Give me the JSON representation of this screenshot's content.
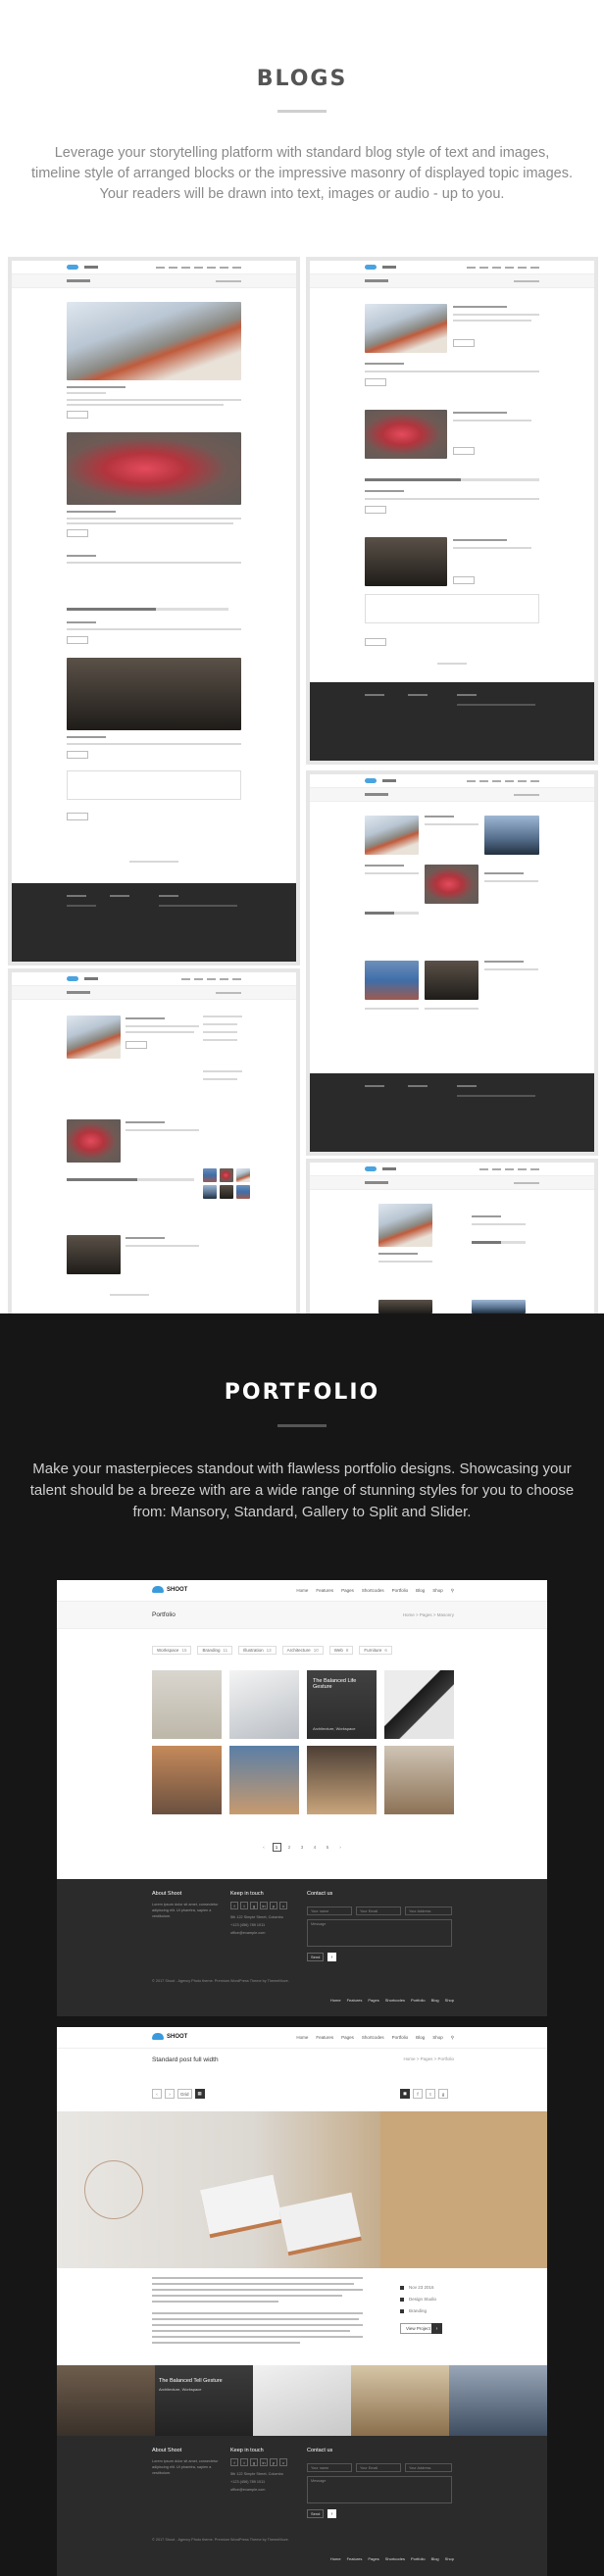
{
  "blogs": {
    "title": "BLOGS",
    "description": "Leverage your storytelling platform with standard blog style of text and images, timeline style of arranged blocks or the impressive masonry of displayed topic images. Your readers will be drawn into text, images or audio - up to you."
  },
  "portfolio": {
    "title": "PORTFOLIO",
    "description": "Make your masterpieces standout with flawless portfolio designs. Showcasing your talent should be a breeze with are a wide range of stunning styles for you to choose from: Mansory, Standard, Gallery to Split and Slider."
  },
  "shot1": {
    "logo": "SHOOT",
    "nav": [
      "Home",
      "Features",
      "Pages",
      "Shortcodes",
      "Portfolio",
      "Blog",
      "Shop"
    ],
    "page_title": "Portfolio",
    "breadcrumb": "Home > Pages > Masonry",
    "filters": [
      {
        "label": "Workspace",
        "count": "15"
      },
      {
        "label": "Branding",
        "count": "11"
      },
      {
        "label": "Illustration",
        "count": "13"
      },
      {
        "label": "Architecture",
        "count": "10"
      },
      {
        "label": "Web",
        "count": "8"
      },
      {
        "label": "Furniture",
        "count": "6"
      }
    ],
    "tile3_caption": "The Balanced Life Gesture",
    "tile3_sub": "Architecture, Workspace",
    "pages": [
      "‹",
      "1",
      "2",
      "3",
      "4",
      "5",
      "›"
    ],
    "footer": {
      "about_title": "About Shoot",
      "about_text": "Lorem ipsum dolor sit amet, consectetur adipiscing elit. Ut pharetra, sapien a vestibulum.",
      "keep_title": "Keep in touch",
      "social": [
        "f",
        "t",
        "g",
        "in",
        "p",
        "v"
      ],
      "address": "5th 122 Simple Street, Colombo",
      "phone": "+123 (456) 789 1011",
      "email": "office@example.com",
      "contact_title": "Contact us",
      "name_ph": "Your name",
      "email_ph": "Your Email",
      "subject_ph": "Your Address",
      "message_ph": "Message",
      "send": "Send",
      "copyright": "© 2017 Shoot - Agency Photo theme. Premium WordPress Theme by ThemeMove.",
      "links": [
        "Home",
        "Features",
        "Pages",
        "Shortcodes",
        "Portfolio",
        "Blog",
        "Shop"
      ]
    }
  },
  "shot2": {
    "logo": "SHOOT",
    "page_title": "Standard post full width",
    "breadcrumb": "Home > Pages > Portfolio",
    "controls_left": [
      "‹",
      "›",
      "Grid",
      "▦"
    ],
    "controls_right": [
      "◼",
      "f",
      "t",
      "g"
    ],
    "meta": [
      {
        "label": "Date",
        "value": "Nov 23 2016"
      },
      {
        "label": "Client",
        "value": "Design Studio"
      },
      {
        "label": "Skills",
        "value": "Branding"
      }
    ],
    "visit_label": "View Project",
    "visit_icon": "›",
    "strip_caption": "The Balanced Tell Gesture",
    "strip_sub": "Architecture, Workspace"
  }
}
